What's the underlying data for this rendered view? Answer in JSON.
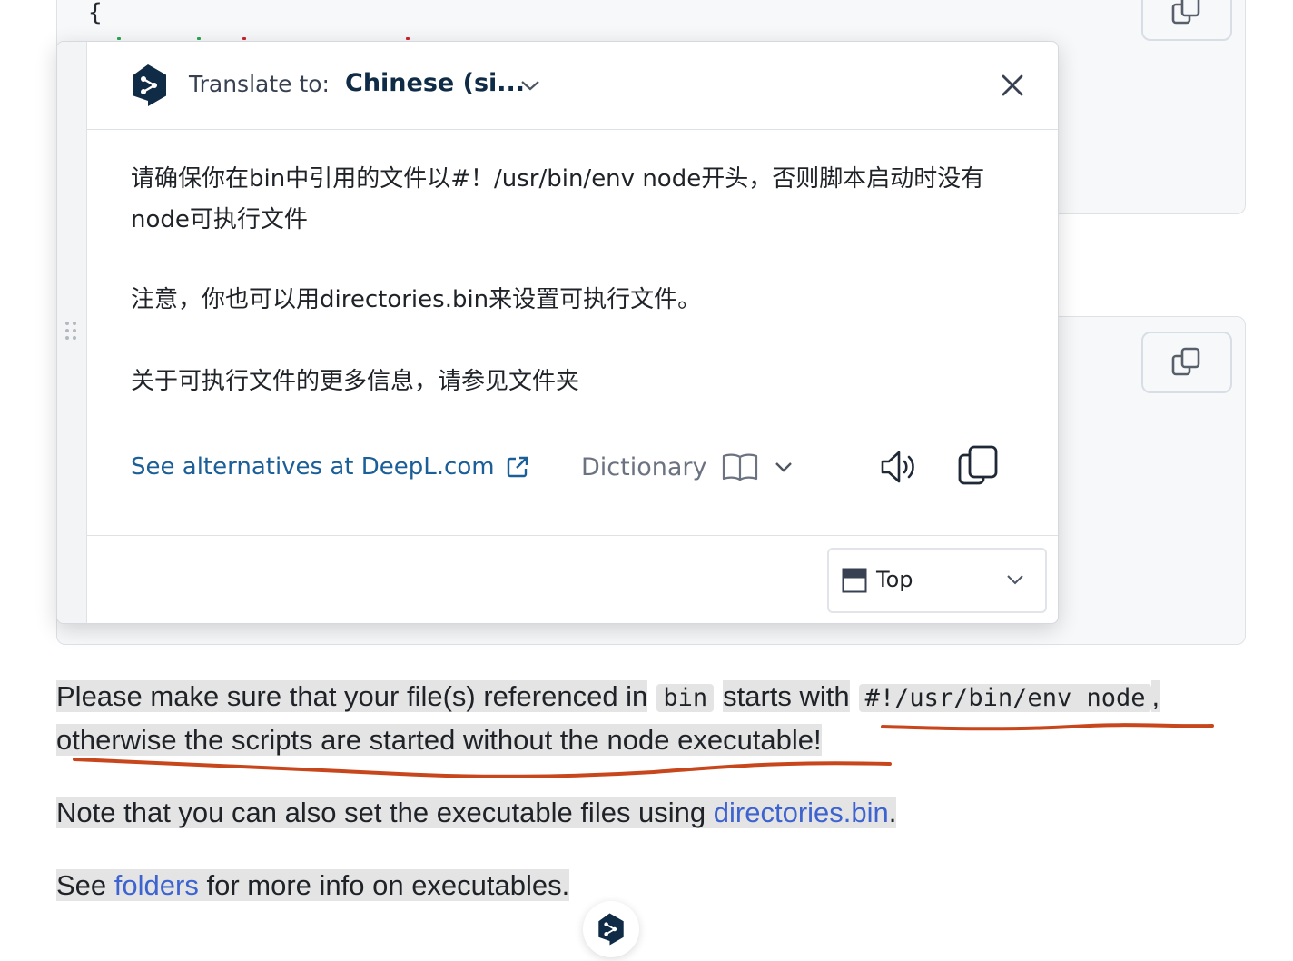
{
  "popup": {
    "translate_label": "Translate to:",
    "target_language": "Chinese (si...",
    "close_icon": "close-icon",
    "translation": {
      "p1": "请确保你在bin中引用的文件以#！/usr/bin/env node开头，否则脚本启动时没有node可执行文件",
      "p2": "注意，你也可以用directories.bin来设置可执行文件。",
      "p3": "关于可执行文件的更多信息，请参见文件夹"
    },
    "alternatives_link": "See alternatives at DeepL.com",
    "dictionary_label": "Dictionary",
    "position": {
      "label": "Top"
    }
  },
  "page": {
    "para1": {
      "text_a": "Please make sure that your file(s) referenced in",
      "code_bin": "bin",
      "text_b": "starts with",
      "code_shebang": "#!/usr/bin/env node",
      "text_c": ",",
      "text_d": "otherwise the scripts are started without the node executable!"
    },
    "para2": {
      "text_a": "Note that you can also set the executable files using",
      "link": "directories.bin",
      "text_b": "."
    },
    "para3": {
      "text_a": "See",
      "link": "folders",
      "text_b": "for more info on executables."
    }
  },
  "colors": {
    "deepl_navy": "#0f2b46",
    "link_blue": "#1b5f98",
    "page_link": "#3d63d0",
    "highlight": "#e4e4e4",
    "annotation_red": "#c8461b"
  }
}
